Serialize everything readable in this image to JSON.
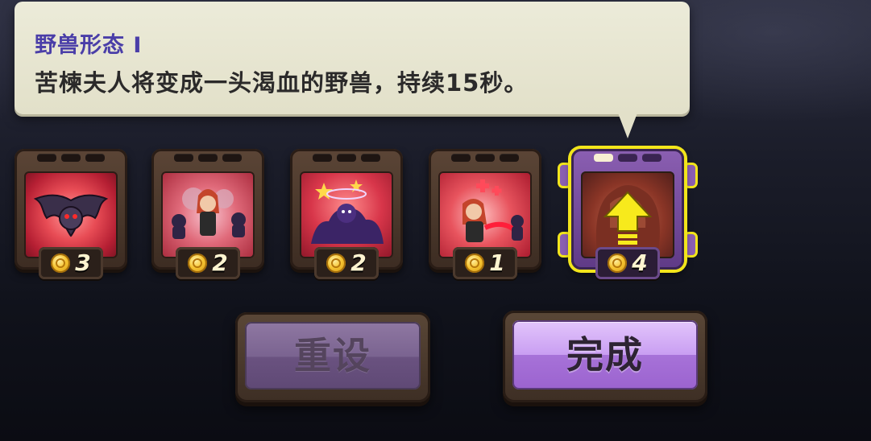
{
  "tooltip": {
    "title": "野兽形态 I",
    "description": "苦楝夫人将变成一头渴血的野兽，持续15秒。"
  },
  "skills": [
    {
      "cost": "3",
      "icon": "bat-icon",
      "selected": false
    },
    {
      "cost": "2",
      "icon": "summon-minions-icon",
      "selected": false
    },
    {
      "cost": "2",
      "icon": "shadow-swarm-icon",
      "selected": false
    },
    {
      "cost": "1",
      "icon": "life-drain-icon",
      "selected": false
    },
    {
      "cost": "4",
      "icon": "upgrade-arrow-icon",
      "selected": true
    }
  ],
  "buttons": {
    "reset_label": "重设",
    "done_label": "完成"
  },
  "colors": {
    "title_text": "#4a3ea8",
    "selected_border": "#f2e51b",
    "button_active": "#c99ef2"
  }
}
